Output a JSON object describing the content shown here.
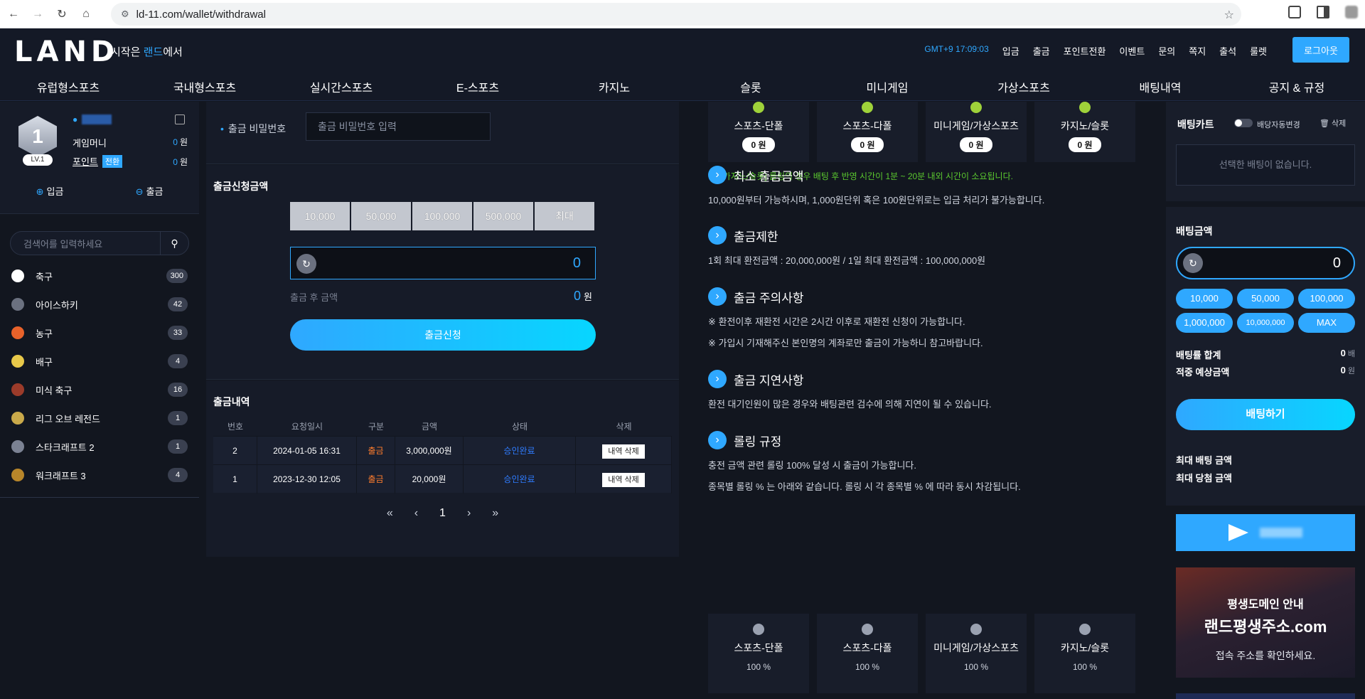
{
  "browser": {
    "url": "ld-11.com/wallet/withdrawal"
  },
  "header": {
    "logo": "LAND",
    "tagline_pre": "시작은 ",
    "tagline_hl": "랜드",
    "tagline_post": "에서",
    "clock": "GMT+9 17:09:03",
    "links": [
      "입금",
      "출금",
      "포인트전환",
      "이벤트",
      "문의",
      "쪽지",
      "출석",
      "룰렛"
    ],
    "logout": "로그아웃",
    "nav": [
      "유럽형스포츠",
      "국내형스포츠",
      "실시간스포츠",
      "E-스포츠",
      "카지노",
      "슬롯",
      "미니게임",
      "가상스포츠",
      "배팅내역",
      "공지 & 규정"
    ]
  },
  "user": {
    "level_number": "1",
    "level": "LV.1",
    "game_money_label": "게임머니",
    "game_money": "0",
    "point_label": "포인트",
    "point_convert": "전환",
    "point": "0",
    "won": "원",
    "deposit": "입금",
    "withdraw": "출금"
  },
  "sidebar": {
    "search_placeholder": "검색어를 입력하세요",
    "sports": [
      {
        "name": "축구",
        "count": "300",
        "color": "#ffffff"
      },
      {
        "name": "아이스하키",
        "count": "42",
        "color": "#6b7180"
      },
      {
        "name": "농구",
        "count": "33",
        "color": "#e8622a"
      },
      {
        "name": "배구",
        "count": "4",
        "color": "#e8c94a"
      },
      {
        "name": "미식 축구",
        "count": "16",
        "color": "#9b3b2a"
      },
      {
        "name": "리그 오브 레전드",
        "count": "1",
        "color": "#c9a94a"
      },
      {
        "name": "스타크래프트 2",
        "count": "1",
        "color": "#7b8293"
      },
      {
        "name": "워크래프트 3",
        "count": "4",
        "color": "#b8862a"
      }
    ]
  },
  "withdraw": {
    "pw_label": "출금 비밀번호",
    "pw_placeholder": "출금 비밀번호 입력",
    "amount_title": "출금신청금액",
    "quick": [
      "10,000",
      "50,000",
      "100,000",
      "500,000",
      "최대"
    ],
    "amount_value": "0",
    "after_label": "출금 후 금액",
    "after_value": "0",
    "after_unit": "원",
    "submit": "출금신청"
  },
  "history": {
    "title": "출금내역",
    "headers": [
      "번호",
      "요청일시",
      "구분",
      "금액",
      "상태",
      "삭제"
    ],
    "rows": [
      {
        "no": "2",
        "date": "2024-01-05 16:31",
        "type": "출금",
        "amount": "3,000,000원",
        "status": "승인완료",
        "del": "내역 삭제"
      },
      {
        "no": "1",
        "date": "2023-12-30 12:05",
        "type": "출금",
        "amount": "20,000원",
        "status": "승인완료",
        "del": "내역 삭제"
      }
    ],
    "page": "1"
  },
  "info": {
    "top_cards": [
      {
        "title": "스포츠-단폴",
        "value": "0 원"
      },
      {
        "title": "스포츠-다폴",
        "value": "0 원"
      },
      {
        "title": "미니게임/가상스포츠",
        "value": "0 원"
      },
      {
        "title": "카지노/슬롯",
        "value": "0 원"
      }
    ],
    "casino_note": "※ [카지노/슬롯] 롤링의 경우 배팅 후 반영 시간이 1분 ~ 20분 내외 시간이 소요됩니다.",
    "sections": [
      {
        "title": "최소 출금금액",
        "lines": [
          "10,000원부터 가능하시며, 1,000원단위 혹은 100원단위로는 입금 처리가 불가능합니다."
        ]
      },
      {
        "title": "출금제한",
        "lines": [
          "1회 최대 환전금액 : 20,000,000원 / 1일 최대 환전금액 : 100,000,000원"
        ]
      },
      {
        "title": "출금 주의사항",
        "lines": [
          "※ 환전이후 재환전 시간은 2시간 이후로 재환전 신청이 가능합니다.",
          "※ 가입시 기재해주신 본인명의 계좌로만 출금이 가능하니 참고바랍니다."
        ]
      },
      {
        "title": "출금 지연사항",
        "lines": [
          "환전 대기인원이 많은 경우와 배팅관련 검수에 의해 지연이 될 수 있습니다."
        ]
      },
      {
        "title": "롤링 규정",
        "lines": [
          "충전 금액 관련 롤링 100% 달성 시 출금이 가능합니다.",
          "종목별 롤링 % 는 아래와 같습니다. 롤링 시 각 종목별 % 에 따라 동시 차감됩니다."
        ]
      }
    ],
    "bottom_cards": [
      {
        "title": "스포츠-단폴",
        "pct": "100 %"
      },
      {
        "title": "스포츠-다폴",
        "pct": "100 %"
      },
      {
        "title": "미니게임/가상스포츠",
        "pct": "100 %"
      },
      {
        "title": "카지노/슬롯",
        "pct": "100 %"
      }
    ]
  },
  "betslip": {
    "title": "배팅카트",
    "auto_label": "배당자동변경",
    "delete": "삭제",
    "empty": "선택한 배팅이 없습니다.",
    "amount_title": "배팅금액",
    "amount_value": "0",
    "chips": [
      "10,000",
      "50,000",
      "100,000",
      "1,000,000",
      "10,000,000",
      "MAX"
    ],
    "odds_label": "배팅률 합계",
    "odds_value": "0",
    "odds_unit": "배",
    "expected_label": "적중 예상금액",
    "expected_value": "0",
    "expected_unit": "원",
    "bet_button": "배팅하기",
    "max_bet_label": "최대 배팅 금액",
    "max_win_label": "최대 당첨 금액",
    "banner_line1": "평생도메인 안내",
    "banner_line2": "랜드평생주소.com",
    "banner_line3": "접속 주소를 확인하세요."
  }
}
